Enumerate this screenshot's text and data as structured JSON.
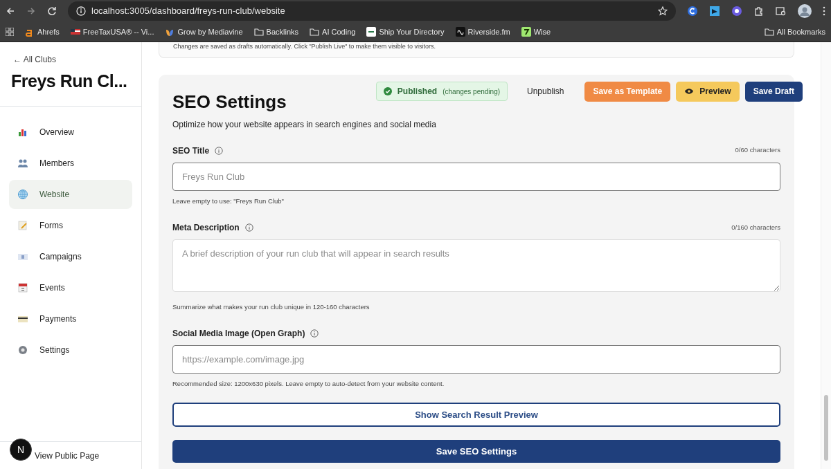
{
  "browser": {
    "url": "localhost:3005/dashboard/freys-run-club/website",
    "bookmarks": [
      {
        "label": "Ahrefs",
        "kind": "ahrefs"
      },
      {
        "label": "FreeTaxUSA® -- Vi...",
        "kind": "flag"
      },
      {
        "label": "Grow by Mediavine",
        "kind": "mediavine"
      },
      {
        "label": "Backlinks",
        "kind": "folder"
      },
      {
        "label": "AI Coding",
        "kind": "folder"
      },
      {
        "label": "Ship Your Directory",
        "kind": "syd"
      },
      {
        "label": "Riverside.fm",
        "kind": "riverside"
      },
      {
        "label": "Wise",
        "kind": "wise"
      }
    ],
    "all_bookmarks": "All Bookmarks"
  },
  "sidebar": {
    "back_link": "← All Clubs",
    "club_name": "Freys Run Cl...",
    "items": [
      {
        "label": "Overview",
        "kind": "chart",
        "selected": false
      },
      {
        "label": "Members",
        "kind": "people",
        "selected": false
      },
      {
        "label": "Website",
        "kind": "globe",
        "selected": true
      },
      {
        "label": "Forms",
        "kind": "memo",
        "selected": false
      },
      {
        "label": "Campaigns",
        "kind": "envelope",
        "selected": false
      },
      {
        "label": "Events",
        "kind": "calendar",
        "selected": false
      },
      {
        "label": "Payments",
        "kind": "card",
        "selected": false
      },
      {
        "label": "Settings",
        "kind": "gear",
        "selected": false
      }
    ],
    "footer_link": "View Public Page",
    "dev_badge": "N"
  },
  "notice": "Changes are saved as drafts automatically. Click \"Publish Live\" to make them visible to visitors.",
  "seo": {
    "title": "SEO Settings",
    "subtitle": "Optimize how your website appears in search engines and social media",
    "status": {
      "label": "Published",
      "detail": "(changes pending)"
    },
    "actions": [
      {
        "label": "Unpublish",
        "kind": "plain"
      },
      {
        "label": "Save as Template",
        "kind": "orange"
      },
      {
        "label": "Preview",
        "kind": "yellow"
      },
      {
        "label": "Save Draft",
        "kind": "navy"
      }
    ],
    "fields": [
      {
        "label": "SEO Title",
        "counter": "0/60 characters",
        "placeholder": "Freys Run Club",
        "kind": "input",
        "help": "Leave empty to use: \"Freys Run Club\""
      },
      {
        "label": "Meta Description",
        "counter": "0/160 characters",
        "placeholder": "A brief description of your run club that will appear in search results",
        "kind": "textarea",
        "help": "Summarize what makes your run club unique in 120-160 characters"
      },
      {
        "label": "Social Media Image (Open Graph)",
        "placeholder": "https://example.com/image.jpg",
        "kind": "input",
        "help": "Recommended size: 1200x630 pixels. Leave empty to auto-detect from your website content."
      }
    ],
    "preview_button": "Show Search Result Preview",
    "save_button": "Save SEO Settings"
  }
}
